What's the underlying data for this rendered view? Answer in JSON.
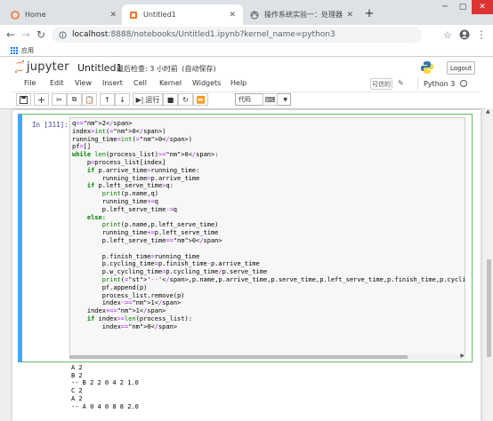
{
  "browser": {
    "tabs": [
      {
        "title": "Home",
        "active": false
      },
      {
        "title": "Untitled1",
        "active": true
      },
      {
        "title": "操作系统实验一：处理器调度算",
        "active": false
      }
    ],
    "new_tab_label": "+",
    "url_host": "localhost",
    "url_path": ":8888/notebooks/Untitled1.ipynb?kernel_name=python3",
    "bookmark_apps_label": "应用"
  },
  "jupyter": {
    "logo_text": "jupyter",
    "notebook_name": "Untitled1",
    "checkpoint": "最后检查: 3 小时前",
    "autosave": "(自动保存)",
    "logout_label": "Logout",
    "menus": [
      "File",
      "Edit",
      "View",
      "Insert",
      "Cell",
      "Kernel",
      "Widgets",
      "Help"
    ],
    "trusted_label": "可信的",
    "kernel_name": "Python 3",
    "run_label": "运行",
    "cell_type": "代码"
  },
  "cell": {
    "prompt": "In  [311]:",
    "code_lines": [
      "q=2",
      "index=int(0)",
      "running_time=int(0)",
      "pf=[]",
      "while len(process_list)>0:",
      "    p=process_list[index]",
      "    if p.arrive_time>running_time:",
      "        running_time=p.arrive_time",
      "    if p.left_serve_time>q:",
      "        print(p.name,q)",
      "        running_time+=q",
      "        p.left_serve_time-=q",
      "    else:",
      "        print(p.name,p.left_serve_time)",
      "        running_time+=p.left_serve_time",
      "        p.left_serve_time=0",
      "",
      "        p.finish_time=running_time",
      "        p.cycling_time=p.finish_time-p.arrive_time",
      "        p.w_cycling_time=p.cycling_time/p.serve_time",
      "        print('--',p.name,p.arrive_time,p.serve_time,p.left_serve_time,p.finish_time,p.cycling_time,p.w_cycling_ti",
      "        pf.append(p)",
      "        process_list.remove(p)",
      "        index-=1",
      "    index+=1",
      "    if index>=len(process_list):",
      "        index=0"
    ],
    "output_lines": [
      "A 2",
      "B 2",
      "-- B 2 2 0 4 2 1.0",
      "C 2",
      "A 2",
      "-- A 0 4 0 8 8 2.0"
    ]
  }
}
